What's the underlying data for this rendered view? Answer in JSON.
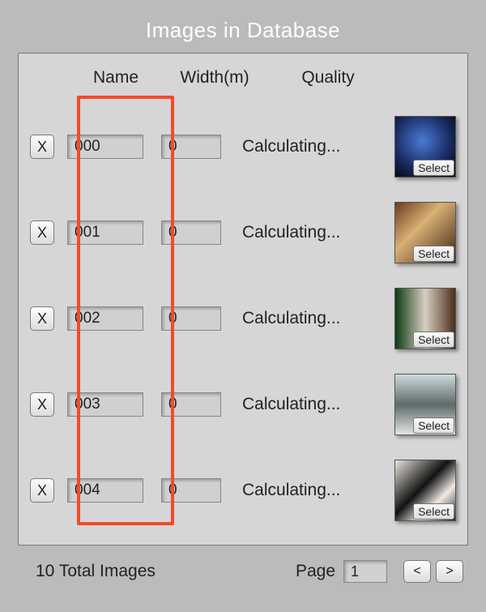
{
  "title": "Images in Database",
  "columns": {
    "name": "Name",
    "width": "Width(m)",
    "quality": "Quality"
  },
  "delete_label": "X",
  "select_label": "Select",
  "rows": [
    {
      "name": "000",
      "width": "0",
      "quality": "Calculating...",
      "thumb_class": "th0"
    },
    {
      "name": "001",
      "width": "0",
      "quality": "Calculating...",
      "thumb_class": "th1"
    },
    {
      "name": "002",
      "width": "0",
      "quality": "Calculating...",
      "thumb_class": "th2"
    },
    {
      "name": "003",
      "width": "0",
      "quality": "Calculating...",
      "thumb_class": "th3"
    },
    {
      "name": "004",
      "width": "0",
      "quality": "Calculating...",
      "thumb_class": "th4"
    }
  ],
  "footer": {
    "total_label": "10 Total Images",
    "page_label": "Page",
    "page_value": "1",
    "prev_label": "<",
    "next_label": ">"
  },
  "highlight": {
    "column": "name"
  }
}
